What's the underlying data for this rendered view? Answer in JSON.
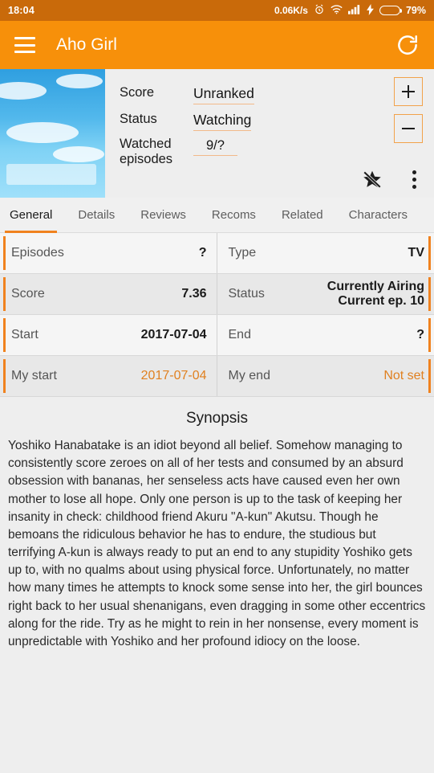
{
  "statusbar": {
    "time": "18:04",
    "net_speed": "0.06K/s",
    "alarm_icon": "alarm-icon",
    "wifi_icon": "wifi-icon",
    "signal_icon": "cellular-signal-icon",
    "charging_icon": "charging-bolt-icon",
    "battery_icon": "battery-icon",
    "battery_percent": "79%",
    "bar_color": "#c96a0a"
  },
  "appbar": {
    "menu_icon": "hamburger-menu-icon",
    "title": "Aho Girl",
    "refresh_icon": "refresh-icon",
    "bar_color": "#f7900a"
  },
  "header": {
    "cover_image": "anime-cover-art",
    "fields": [
      {
        "label": "Score",
        "value": "Unranked"
      },
      {
        "label": "Status",
        "value": "Watching"
      },
      {
        "label": "Watched episodes",
        "value": "9/?"
      }
    ],
    "score_label": "Score",
    "score_value": "Unranked",
    "status_label": "Status",
    "status_value": "Watching",
    "watched_label": "Watched episodes",
    "watched_value": "9/?",
    "increment_label": "+",
    "decrement_label": "−",
    "favorite_icon": "star-off-icon",
    "overflow_icon": "more-vertical-icon",
    "accent_color": "#f0821e",
    "underline_color": "#f2b98a"
  },
  "tabs": {
    "active_index": 0,
    "items": [
      {
        "label": "General"
      },
      {
        "label": "Details"
      },
      {
        "label": "Reviews"
      },
      {
        "label": "Recoms"
      },
      {
        "label": "Related"
      },
      {
        "label": "Characters"
      }
    ]
  },
  "info_grid": {
    "rows": [
      {
        "left": {
          "key": "Episodes",
          "value": "?",
          "accent": false
        },
        "right": {
          "key": "Type",
          "value": "TV",
          "accent": false
        }
      },
      {
        "left": {
          "key": "Score",
          "value": "7.36",
          "accent": false
        },
        "right": {
          "key": "Status",
          "value": "Currently Airing\nCurrent ep. 10",
          "accent": false
        }
      },
      {
        "left": {
          "key": "Start",
          "value": "2017-07-04",
          "accent": false
        },
        "right": {
          "key": "End",
          "value": "?",
          "accent": false
        }
      },
      {
        "left": {
          "key": "My start",
          "value": "2017-07-04",
          "accent": true
        },
        "right": {
          "key": "My end",
          "value": "Not set",
          "accent": true
        }
      }
    ]
  },
  "synopsis": {
    "title": "Synopsis",
    "text": "Yoshiko Hanabatake is an idiot beyond all belief. Somehow managing to consistently score zeroes on all of her tests and consumed by an absurd obsession with bananas, her senseless acts have caused even her own mother to lose all hope. Only one person is up to the task of keeping her insanity in check: childhood friend Akuru \"A-kun\" Akutsu. Though he bemoans the ridiculous behavior he has to endure, the studious but terrifying A-kun is always ready to put an end to any stupidity Yoshiko gets up to, with no qualms about using physical force. Unfortunately, no matter how many times he attempts to knock some sense into her, the girl bounces right back to her usual shenanigans, even dragging in some other eccentrics along for the ride. Try as he might to rein in her nonsense, every moment is unpredictable with Yoshiko and her profound idiocy on the loose."
  }
}
